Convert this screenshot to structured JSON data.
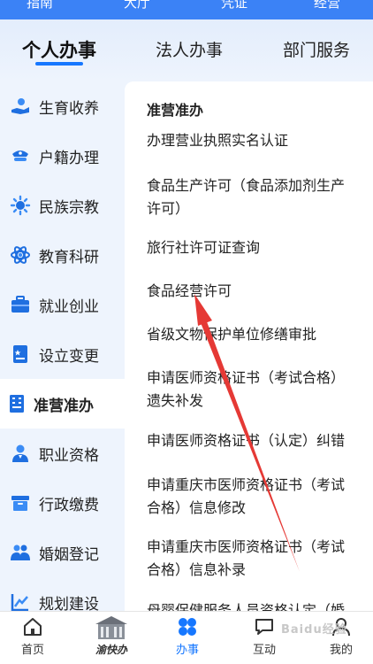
{
  "top_bar": {
    "items": [
      "指南",
      "大厅",
      "凭证",
      "经营"
    ]
  },
  "tabs": [
    {
      "label": "个人办事",
      "active": true
    },
    {
      "label": "法人办事",
      "active": false
    },
    {
      "label": "部门服务",
      "active": false
    }
  ],
  "sidebar": {
    "items": [
      {
        "label": "生育收养",
        "icon": "hand-heart-icon"
      },
      {
        "label": "户籍办理",
        "icon": "police-cap-icon"
      },
      {
        "label": "民族宗教",
        "icon": "sun-icon"
      },
      {
        "label": "教育科研",
        "icon": "atom-icon"
      },
      {
        "label": "就业创业",
        "icon": "briefcase-icon"
      },
      {
        "label": "设立变更",
        "icon": "document-star-icon"
      },
      {
        "label": "准营准办",
        "icon": "building-icon",
        "active": true
      },
      {
        "label": "职业资格",
        "icon": "person-badge-icon"
      },
      {
        "label": "行政缴费",
        "icon": "box-icon"
      },
      {
        "label": "婚姻登记",
        "icon": "couple-icon"
      },
      {
        "label": "规划建设",
        "icon": "chart-ruler-icon"
      }
    ]
  },
  "content": {
    "section_title": "准营准办",
    "entries": [
      {
        "line1": "办理营业执照实名认证",
        "line2": ""
      },
      {
        "line1": "食品生产许可（食品添加剂生产",
        "line2": "许可）"
      },
      {
        "line1": "旅行社许可证查询",
        "line2": ""
      },
      {
        "line1": "食品经营许可",
        "line2": ""
      },
      {
        "line1": "省级文物保护单位修缮审批",
        "line2": ""
      },
      {
        "line1": "申请医师资格证书（考试合格）",
        "line2": "遗失补发"
      },
      {
        "line1": "申请医师资格证书（认定）纠错",
        "line2": ""
      },
      {
        "line1": "申请重庆市医师资格证书（考试",
        "line2": "合格）信息修改"
      },
      {
        "line1": "申请重庆市医师资格证书（考试",
        "line2": "合格）信息补录"
      },
      {
        "line1": "母婴保健服务人员资格认定（婚",
        "line2": ""
      }
    ]
  },
  "bottom_nav": {
    "items": [
      {
        "label": "首页",
        "icon": "home-icon"
      },
      {
        "label": "渝快办",
        "icon": "yukuaiban-logo-icon"
      },
      {
        "label": "办事",
        "icon": "grid-icon",
        "active": true
      },
      {
        "label": "互动",
        "icon": "chat-icon"
      },
      {
        "label": "我的",
        "icon": "user-icon"
      }
    ]
  },
  "watermark": "Baidu经验",
  "colors": {
    "accent": "#1677ff",
    "annotation": "#e53935",
    "sidebar_bg": "#eef4fd"
  }
}
